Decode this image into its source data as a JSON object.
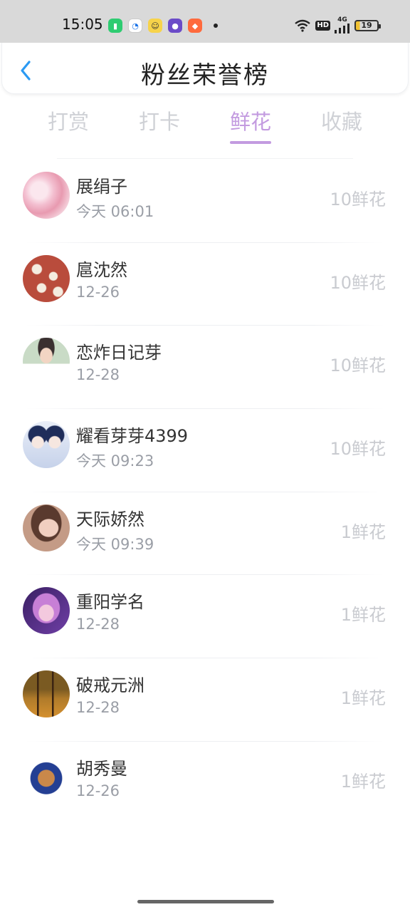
{
  "status_bar": {
    "time": "15:05",
    "hd": "HD",
    "network": "4G",
    "battery": "19"
  },
  "header": {
    "title": "粉丝荣誉榜"
  },
  "tabs": [
    {
      "label": "打赏",
      "active": false
    },
    {
      "label": "打卡",
      "active": false
    },
    {
      "label": "鲜花",
      "active": true
    },
    {
      "label": "收藏",
      "active": false
    }
  ],
  "colors": {
    "accent": "#c39be0",
    "back_arrow": "#2b9af3"
  },
  "fans": [
    {
      "name": "展绢子",
      "time": "今天 06:01",
      "count": "10鲜花"
    },
    {
      "name": "扈沈然",
      "time": "12-26",
      "count": "10鲜花"
    },
    {
      "name": "恋炸日记芽",
      "time": "12-28",
      "count": "10鲜花"
    },
    {
      "name": "耀看芽芽4399",
      "time": "今天 09:23",
      "count": "10鲜花"
    },
    {
      "name": "天际娇然",
      "time": "今天 09:39",
      "count": "1鲜花"
    },
    {
      "name": "重阳学名",
      "time": "12-28",
      "count": "1鲜花"
    },
    {
      "name": "破戒元洲",
      "time": "12-28",
      "count": "1鲜花"
    },
    {
      "name": "胡秀曼",
      "time": "12-26",
      "count": "1鲜花"
    }
  ]
}
